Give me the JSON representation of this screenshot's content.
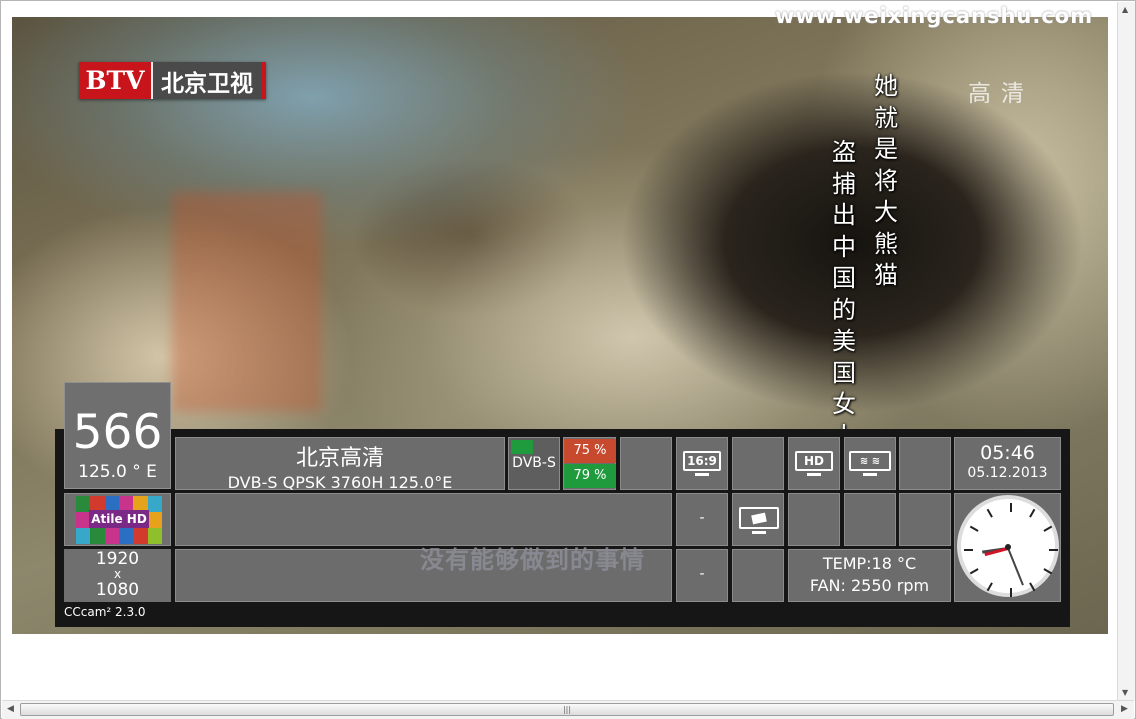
{
  "watermark": "www.weixingcanshu.com",
  "channel_logo": {
    "btv": "BTV",
    "name": "北京卫视"
  },
  "hd_label": "高清",
  "subtitles": {
    "vertical_right": "她就是将大熊猫",
    "vertical_left": "盗捕出中国的美国女人",
    "horizontal": "没有能够做到的事情"
  },
  "infobar": {
    "channel_number": "566",
    "orbital_position": "125.0 ° E",
    "channel_name": "北京高清",
    "tuning": "DVB-S QPSK 3760H 125.0°E",
    "delivery": "DVB-S",
    "signal_strength": "75 %",
    "signal_quality": "79 %",
    "aspect_ratio": "16:9",
    "hd_badge": "HD",
    "time": "05:46",
    "date": "05.12.2013",
    "provider_logo": "Atile HD",
    "resolution_width": "1920",
    "resolution_x": "x",
    "resolution_height": "1080",
    "dash1": "-",
    "dash2": "-",
    "temp": "TEMP:18 °C",
    "fan": "FAN: 2550 rpm",
    "cam": "CCcam² 2.3.0"
  },
  "colors": {
    "bar_bg": "#161616",
    "cell_bg": "#6c6c6c",
    "btv_red": "#c8141b",
    "signal_red": "#c84a2e",
    "signal_green": "#1f9a3c"
  }
}
